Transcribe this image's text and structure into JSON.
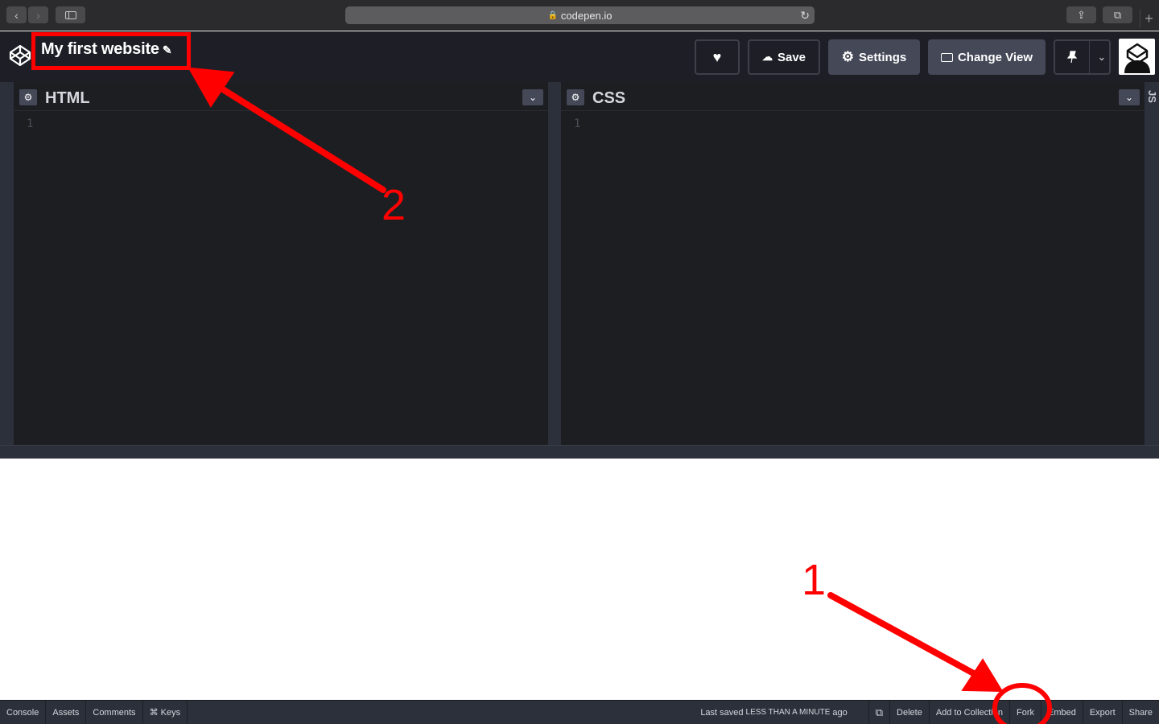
{
  "browser": {
    "url": "codepen.io",
    "nav_back": "‹",
    "nav_forward": "›",
    "share_icon": "⇪",
    "tabs_icon": "⧉",
    "new_tab": "+"
  },
  "header": {
    "pen_title": "My first website",
    "pencil": "✎",
    "buttons": {
      "heart": "♥",
      "save": "Save",
      "settings": "Settings",
      "change_view": "Change View"
    }
  },
  "editors": {
    "html": {
      "title": "HTML",
      "line": "1"
    },
    "css": {
      "title": "CSS",
      "line": "1"
    },
    "js": {
      "title": "JS"
    },
    "gear": "⚙",
    "collapse": "⌄"
  },
  "footer": {
    "left": [
      "Console",
      "Assets",
      "Comments",
      "⌘ Keys"
    ],
    "last_saved_prefix": "Last saved",
    "last_saved_caps": "LESS THAN A MINUTE",
    "last_saved_suffix": "ago",
    "external_icon": "⧉",
    "right": [
      "Delete",
      "Add to Collection",
      "Fork",
      "Embed",
      "Export",
      "Share"
    ]
  },
  "annotations": {
    "number_1": "1",
    "number_2": "2",
    "color": "#ff0000"
  }
}
